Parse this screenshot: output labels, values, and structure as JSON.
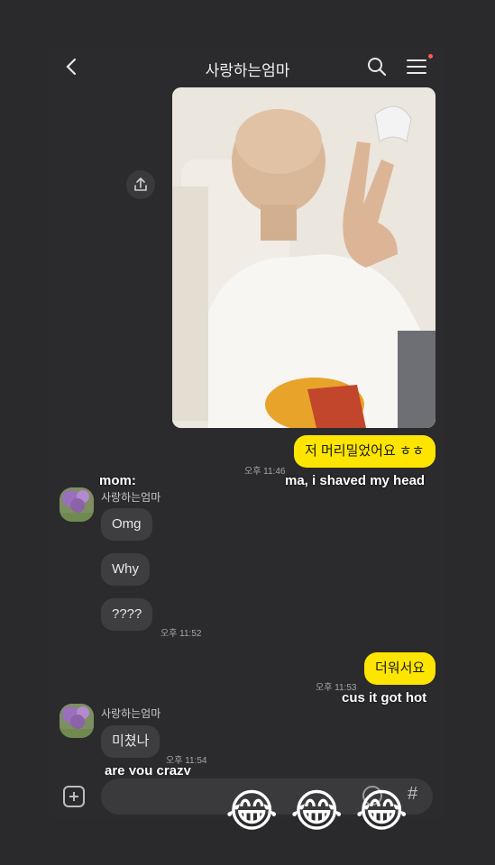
{
  "header": {
    "title": "사랑하는엄마",
    "back_icon": "chevron-left-icon",
    "search_icon": "search-icon",
    "menu_icon": "hamburger-menu-icon",
    "notification_dot_color": "#ff5a4a"
  },
  "messages": {
    "sent_1": {
      "text": "저 머리밀었어요 ㅎㅎ",
      "time": "오후 11:46",
      "caption": "ma, i shaved my head"
    },
    "mom_label": "mom:",
    "sender_name": "사랑하는엄마",
    "received_1": {
      "lines": [
        "Omg",
        "Why",
        "????"
      ],
      "time": "오후 11:52"
    },
    "sent_2": {
      "text": "더워서요",
      "time": "오후 11:53",
      "caption": "cus it got hot"
    },
    "sender_name_2": "사랑하는엄마",
    "received_2": {
      "text": "미쳤나",
      "time": "오후 11:54",
      "caption": "are you crazy"
    }
  },
  "input": {
    "plus_icon": "plus-icon",
    "emoji_icon": "emoji-icon",
    "hash_label": "#"
  },
  "stickers": [
    "😂",
    "😂",
    "😂"
  ],
  "colors": {
    "bubble_mine": "#fee500",
    "bubble_theirs": "#3e3e40",
    "background": "#2b2b2d"
  }
}
